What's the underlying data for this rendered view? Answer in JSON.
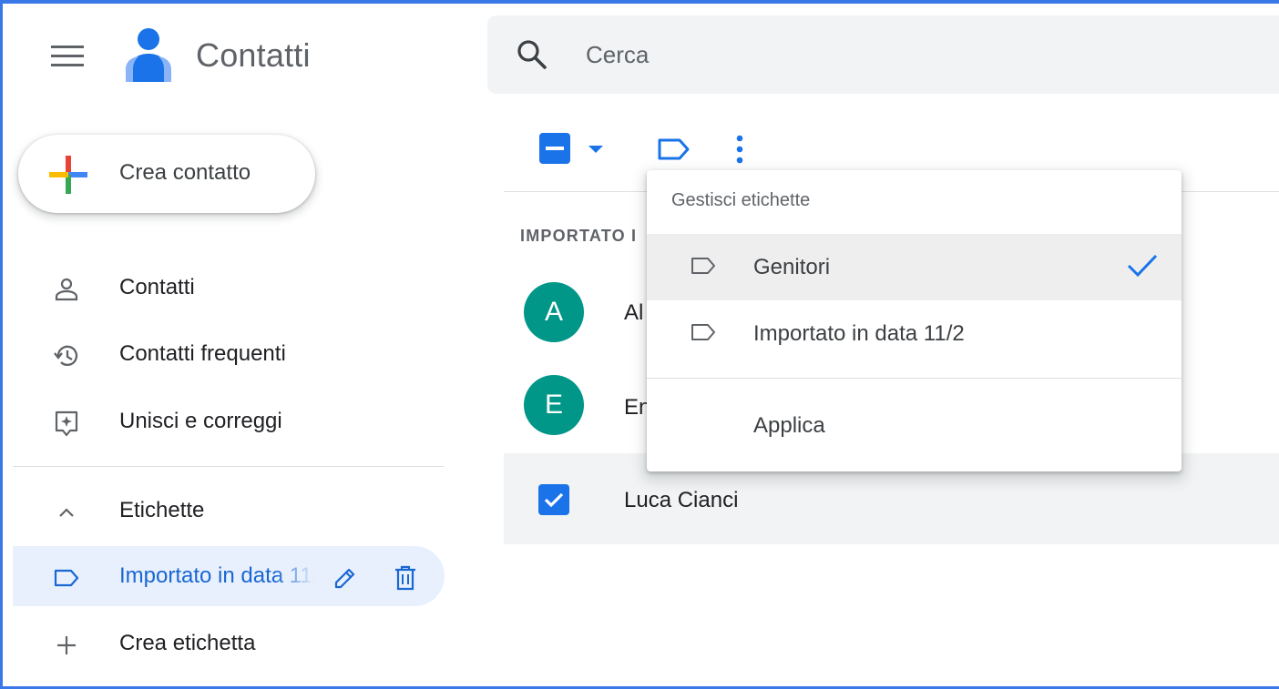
{
  "app": {
    "title": "Contatti"
  },
  "search": {
    "placeholder": "Cerca"
  },
  "sidebar": {
    "create_label": "Crea contatto",
    "items": [
      {
        "label": "Contatti",
        "icon": "person-icon"
      },
      {
        "label": "Contatti frequenti",
        "icon": "history-icon"
      },
      {
        "label": "Unisci e correggi",
        "icon": "merge-icon"
      }
    ],
    "labels_section": {
      "label": "Etichette",
      "icon": "chevron-up-icon"
    },
    "label_items": [
      {
        "label": "Importato in data 11/2",
        "icon": "label-icon",
        "active": true
      }
    ],
    "create_label_item": {
      "label": "Crea etichetta",
      "icon": "plus-icon"
    }
  },
  "toolbar": {
    "checkbox_state": "indeterminate",
    "icons": [
      "select-dropdown-icon",
      "label-icon",
      "more-vert-icon"
    ]
  },
  "contacts": {
    "section_header": "IMPORTATO I",
    "rows": [
      {
        "initial": "A",
        "name": "Al",
        "selected": false
      },
      {
        "initial": "E",
        "name": "En",
        "selected": false
      },
      {
        "initial": "",
        "name": "Luca Cianci",
        "selected": true
      }
    ]
  },
  "label_menu": {
    "title": "Gestisci etichette",
    "items": [
      {
        "label": "Genitori",
        "checked": true
      },
      {
        "label": "Importato in data 11/2",
        "checked": false
      }
    ],
    "apply_label": "Applica"
  },
  "colors": {
    "accent": "#1a73e8",
    "avatar": "#009688",
    "active_nav_bg": "#e8f0fe",
    "frame": "#3b78e7"
  }
}
